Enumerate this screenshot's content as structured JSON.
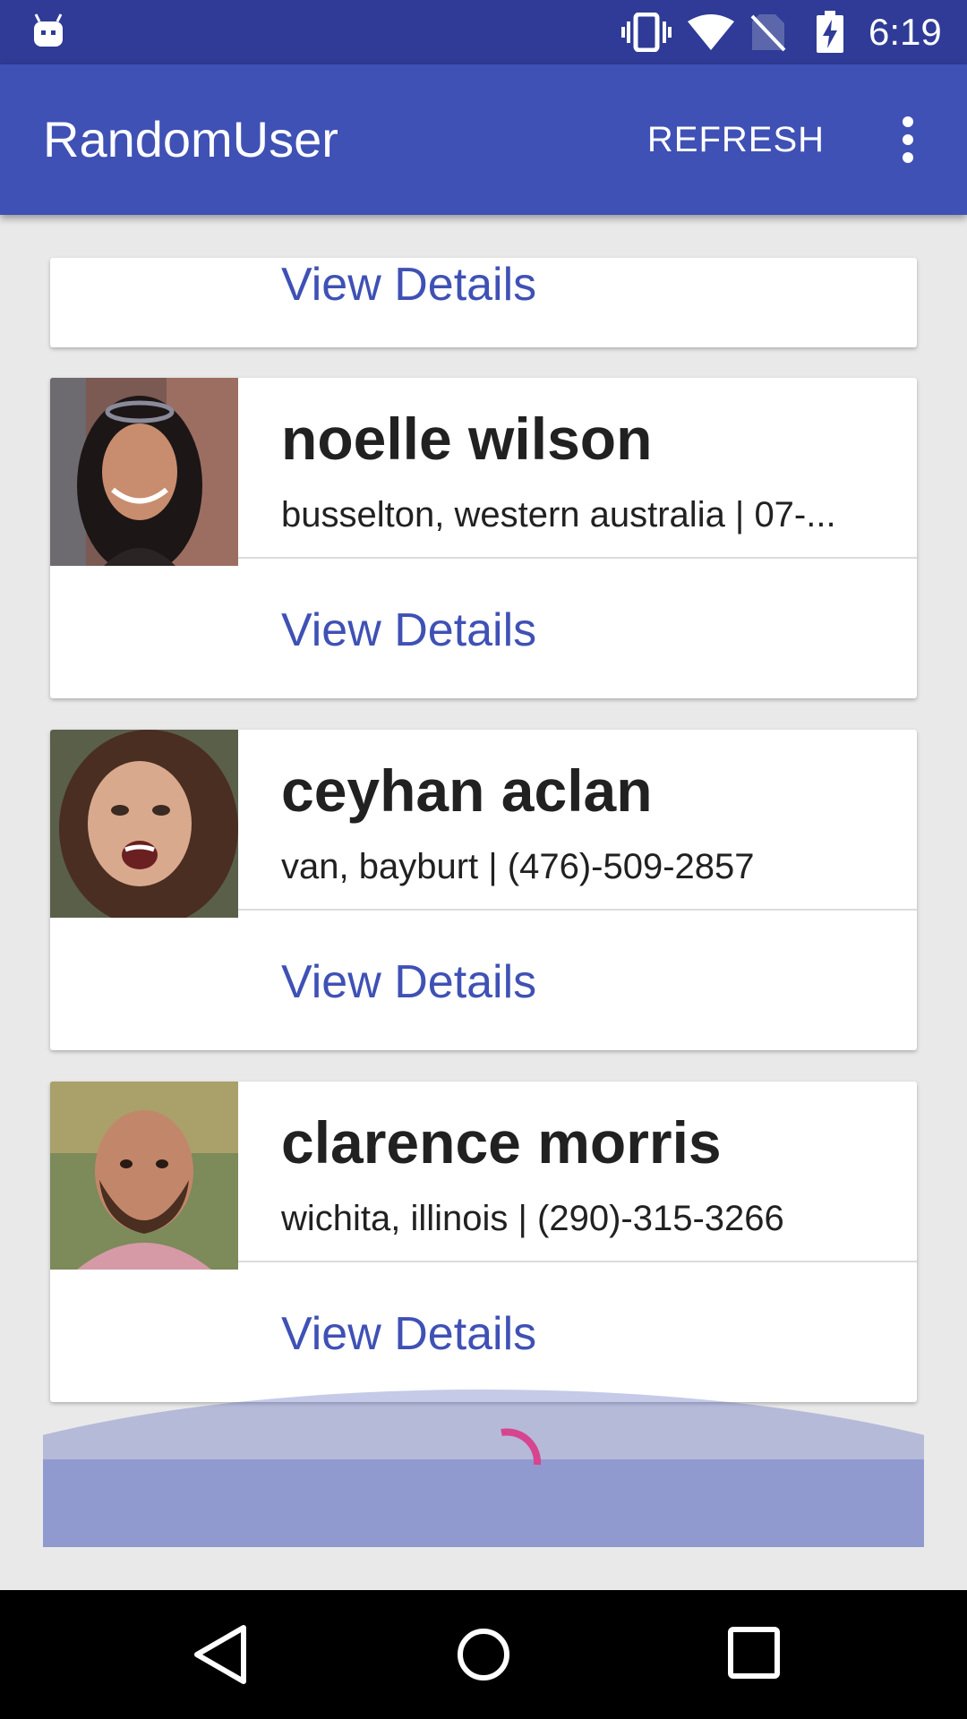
{
  "status_bar": {
    "time": "6:19",
    "icons": [
      "android-icon",
      "vibrate-icon",
      "wifi-icon",
      "no-sim-icon",
      "battery-charging-icon"
    ]
  },
  "app_bar": {
    "title": "RandomUser",
    "refresh_label": "REFRESH",
    "overflow_icon": "more-vert-icon"
  },
  "partial_card": {
    "action_label": "View Details"
  },
  "users": [
    {
      "name": "noelle wilson",
      "info": "busselton, western australia | 07-...",
      "action_label": "View Details"
    },
    {
      "name": "ceyhan aclan",
      "info": "van, bayburt | (476)-509-2857",
      "action_label": "View Details"
    },
    {
      "name": "clarence morris",
      "info": "wichita, illinois | (290)-315-3266",
      "action_label": "View Details"
    }
  ],
  "colors": {
    "primary": "#3f51b5",
    "primary_dark": "#2f3b96",
    "accent": "#d6458f",
    "background": "#e9e9e9"
  },
  "nav_bar": {
    "icons": [
      "back-icon",
      "home-icon",
      "recents-icon"
    ]
  }
}
